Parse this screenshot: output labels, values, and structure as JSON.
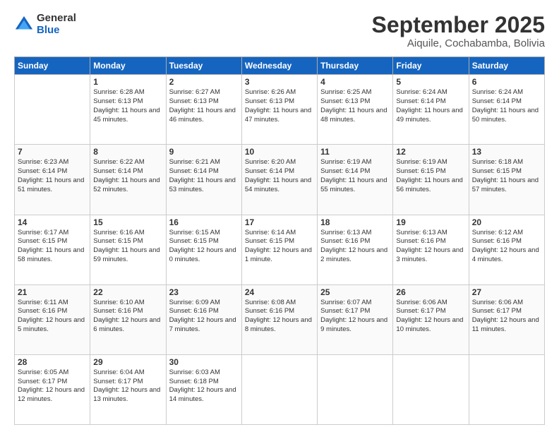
{
  "logo": {
    "general": "General",
    "blue": "Blue"
  },
  "header": {
    "title": "September 2025",
    "subtitle": "Aiquile, Cochabamba, Bolivia"
  },
  "weekdays": [
    "Sunday",
    "Monday",
    "Tuesday",
    "Wednesday",
    "Thursday",
    "Friday",
    "Saturday"
  ],
  "weeks": [
    [
      {
        "day": "",
        "sunrise": "",
        "sunset": "",
        "daylight": ""
      },
      {
        "day": "1",
        "sunrise": "Sunrise: 6:28 AM",
        "sunset": "Sunset: 6:13 PM",
        "daylight": "Daylight: 11 hours and 45 minutes."
      },
      {
        "day": "2",
        "sunrise": "Sunrise: 6:27 AM",
        "sunset": "Sunset: 6:13 PM",
        "daylight": "Daylight: 11 hours and 46 minutes."
      },
      {
        "day": "3",
        "sunrise": "Sunrise: 6:26 AM",
        "sunset": "Sunset: 6:13 PM",
        "daylight": "Daylight: 11 hours and 47 minutes."
      },
      {
        "day": "4",
        "sunrise": "Sunrise: 6:25 AM",
        "sunset": "Sunset: 6:13 PM",
        "daylight": "Daylight: 11 hours and 48 minutes."
      },
      {
        "day": "5",
        "sunrise": "Sunrise: 6:24 AM",
        "sunset": "Sunset: 6:14 PM",
        "daylight": "Daylight: 11 hours and 49 minutes."
      },
      {
        "day": "6",
        "sunrise": "Sunrise: 6:24 AM",
        "sunset": "Sunset: 6:14 PM",
        "daylight": "Daylight: 11 hours and 50 minutes."
      }
    ],
    [
      {
        "day": "7",
        "sunrise": "Sunrise: 6:23 AM",
        "sunset": "Sunset: 6:14 PM",
        "daylight": "Daylight: 11 hours and 51 minutes."
      },
      {
        "day": "8",
        "sunrise": "Sunrise: 6:22 AM",
        "sunset": "Sunset: 6:14 PM",
        "daylight": "Daylight: 11 hours and 52 minutes."
      },
      {
        "day": "9",
        "sunrise": "Sunrise: 6:21 AM",
        "sunset": "Sunset: 6:14 PM",
        "daylight": "Daylight: 11 hours and 53 minutes."
      },
      {
        "day": "10",
        "sunrise": "Sunrise: 6:20 AM",
        "sunset": "Sunset: 6:14 PM",
        "daylight": "Daylight: 11 hours and 54 minutes."
      },
      {
        "day": "11",
        "sunrise": "Sunrise: 6:19 AM",
        "sunset": "Sunset: 6:14 PM",
        "daylight": "Daylight: 11 hours and 55 minutes."
      },
      {
        "day": "12",
        "sunrise": "Sunrise: 6:19 AM",
        "sunset": "Sunset: 6:15 PM",
        "daylight": "Daylight: 11 hours and 56 minutes."
      },
      {
        "day": "13",
        "sunrise": "Sunrise: 6:18 AM",
        "sunset": "Sunset: 6:15 PM",
        "daylight": "Daylight: 11 hours and 57 minutes."
      }
    ],
    [
      {
        "day": "14",
        "sunrise": "Sunrise: 6:17 AM",
        "sunset": "Sunset: 6:15 PM",
        "daylight": "Daylight: 11 hours and 58 minutes."
      },
      {
        "day": "15",
        "sunrise": "Sunrise: 6:16 AM",
        "sunset": "Sunset: 6:15 PM",
        "daylight": "Daylight: 11 hours and 59 minutes."
      },
      {
        "day": "16",
        "sunrise": "Sunrise: 6:15 AM",
        "sunset": "Sunset: 6:15 PM",
        "daylight": "Daylight: 12 hours and 0 minutes."
      },
      {
        "day": "17",
        "sunrise": "Sunrise: 6:14 AM",
        "sunset": "Sunset: 6:15 PM",
        "daylight": "Daylight: 12 hours and 1 minute."
      },
      {
        "day": "18",
        "sunrise": "Sunrise: 6:13 AM",
        "sunset": "Sunset: 6:16 PM",
        "daylight": "Daylight: 12 hours and 2 minutes."
      },
      {
        "day": "19",
        "sunrise": "Sunrise: 6:13 AM",
        "sunset": "Sunset: 6:16 PM",
        "daylight": "Daylight: 12 hours and 3 minutes."
      },
      {
        "day": "20",
        "sunrise": "Sunrise: 6:12 AM",
        "sunset": "Sunset: 6:16 PM",
        "daylight": "Daylight: 12 hours and 4 minutes."
      }
    ],
    [
      {
        "day": "21",
        "sunrise": "Sunrise: 6:11 AM",
        "sunset": "Sunset: 6:16 PM",
        "daylight": "Daylight: 12 hours and 5 minutes."
      },
      {
        "day": "22",
        "sunrise": "Sunrise: 6:10 AM",
        "sunset": "Sunset: 6:16 PM",
        "daylight": "Daylight: 12 hours and 6 minutes."
      },
      {
        "day": "23",
        "sunrise": "Sunrise: 6:09 AM",
        "sunset": "Sunset: 6:16 PM",
        "daylight": "Daylight: 12 hours and 7 minutes."
      },
      {
        "day": "24",
        "sunrise": "Sunrise: 6:08 AM",
        "sunset": "Sunset: 6:16 PM",
        "daylight": "Daylight: 12 hours and 8 minutes."
      },
      {
        "day": "25",
        "sunrise": "Sunrise: 6:07 AM",
        "sunset": "Sunset: 6:17 PM",
        "daylight": "Daylight: 12 hours and 9 minutes."
      },
      {
        "day": "26",
        "sunrise": "Sunrise: 6:06 AM",
        "sunset": "Sunset: 6:17 PM",
        "daylight": "Daylight: 12 hours and 10 minutes."
      },
      {
        "day": "27",
        "sunrise": "Sunrise: 6:06 AM",
        "sunset": "Sunset: 6:17 PM",
        "daylight": "Daylight: 12 hours and 11 minutes."
      }
    ],
    [
      {
        "day": "28",
        "sunrise": "Sunrise: 6:05 AM",
        "sunset": "Sunset: 6:17 PM",
        "daylight": "Daylight: 12 hours and 12 minutes."
      },
      {
        "day": "29",
        "sunrise": "Sunrise: 6:04 AM",
        "sunset": "Sunset: 6:17 PM",
        "daylight": "Daylight: 12 hours and 13 minutes."
      },
      {
        "day": "30",
        "sunrise": "Sunrise: 6:03 AM",
        "sunset": "Sunset: 6:18 PM",
        "daylight": "Daylight: 12 hours and 14 minutes."
      },
      {
        "day": "",
        "sunrise": "",
        "sunset": "",
        "daylight": ""
      },
      {
        "day": "",
        "sunrise": "",
        "sunset": "",
        "daylight": ""
      },
      {
        "day": "",
        "sunrise": "",
        "sunset": "",
        "daylight": ""
      },
      {
        "day": "",
        "sunrise": "",
        "sunset": "",
        "daylight": ""
      }
    ]
  ]
}
